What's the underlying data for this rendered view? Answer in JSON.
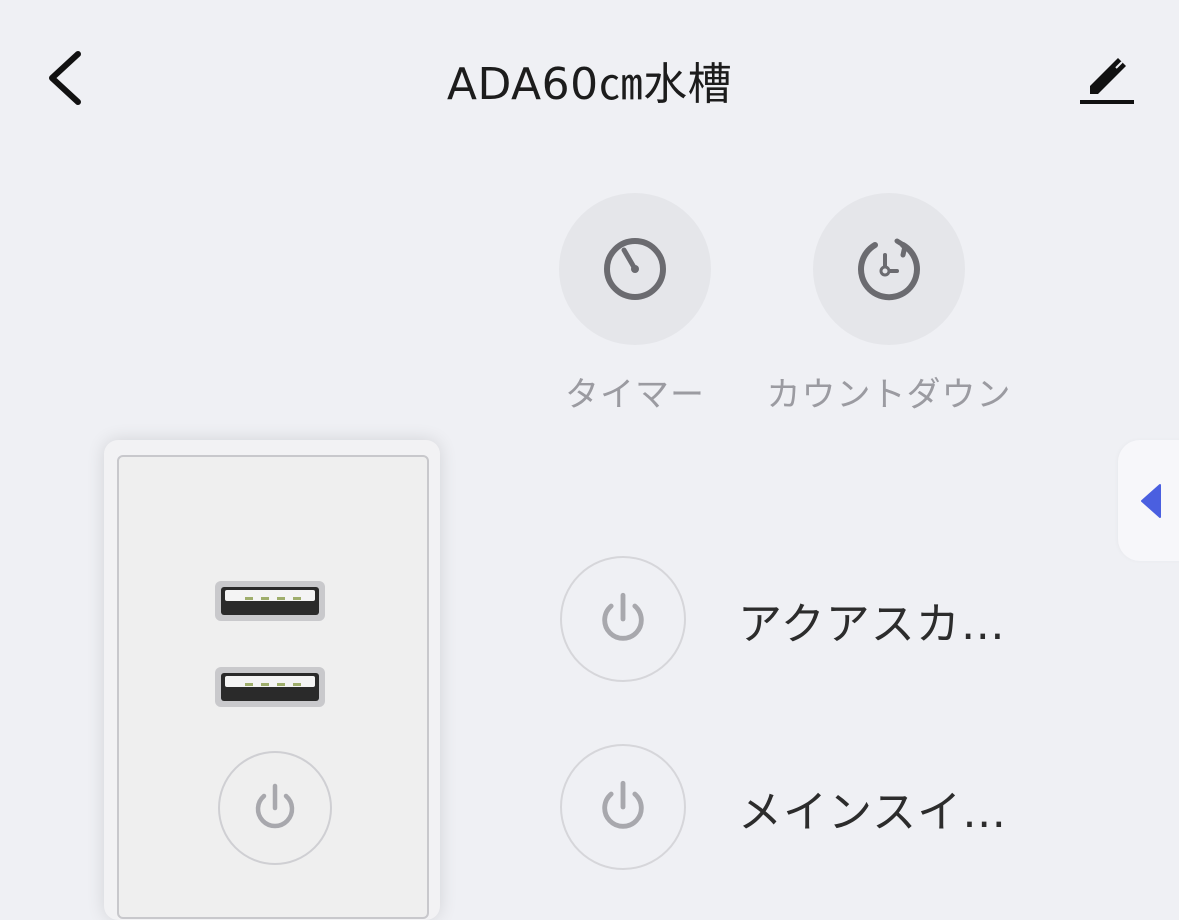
{
  "header": {
    "title": "ADA60㎝水槽",
    "back_icon": "chevron-left-icon",
    "edit_icon": "pencil-icon"
  },
  "actions": [
    {
      "label": "タイマー",
      "icon": "timer-icon"
    },
    {
      "label": "カウントダウン",
      "icon": "countdown-icon"
    }
  ],
  "outlets": [
    {
      "name": "アクアスカ…",
      "icon": "power-icon"
    },
    {
      "name": "メインスイ…",
      "icon": "power-icon"
    }
  ],
  "colors": {
    "background": "#eff0f4",
    "action_circle": "#e5e6ea",
    "accent": "#4a5fe0"
  }
}
